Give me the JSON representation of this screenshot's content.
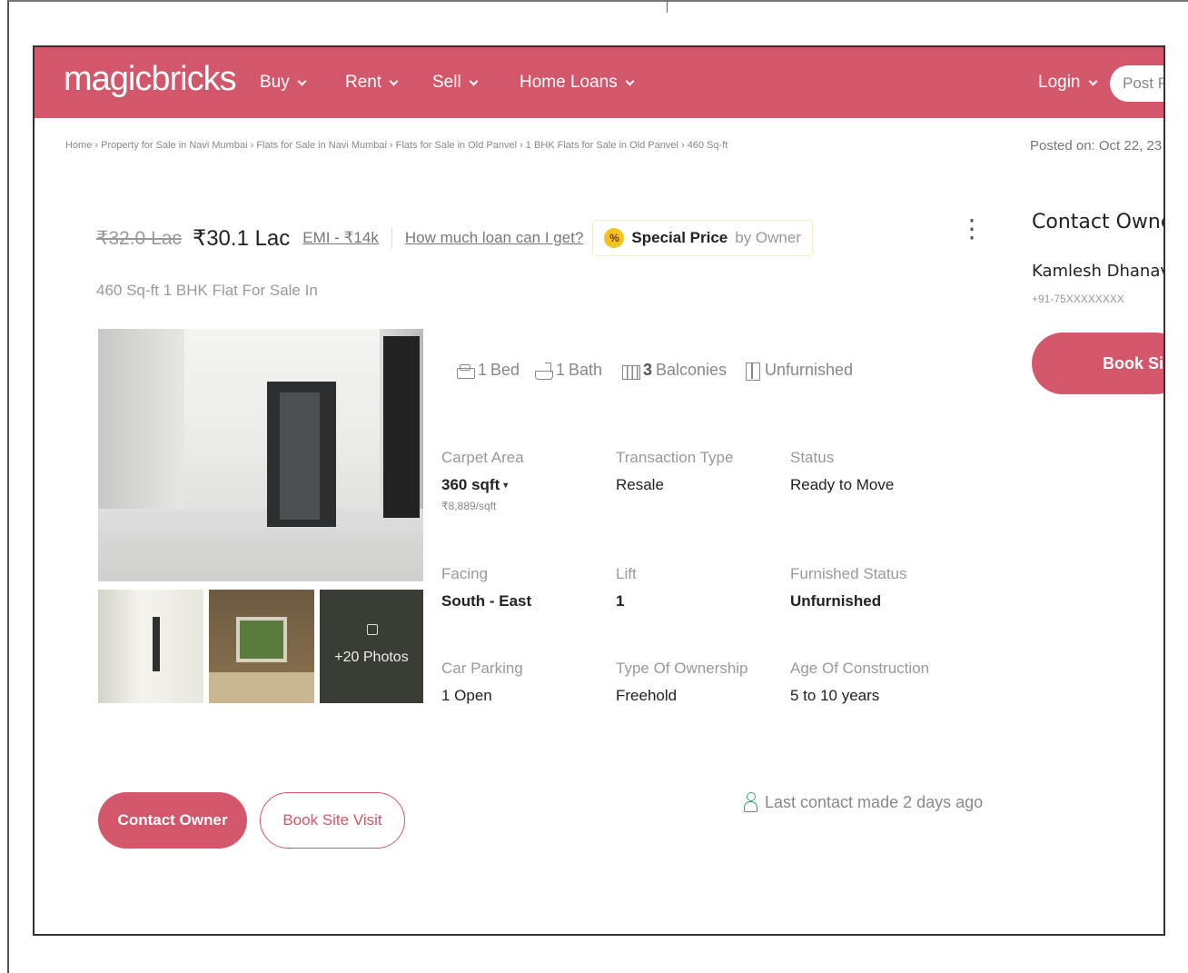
{
  "brand": {
    "logo": "magicbricks",
    "accent": "#d3576a"
  },
  "nav": {
    "items": [
      {
        "label": "Buy"
      },
      {
        "label": "Rent"
      },
      {
        "label": "Sell"
      },
      {
        "label": "Home Loans"
      }
    ],
    "login": "Login",
    "post_button": "Post P"
  },
  "breadcrumb": "Home › Property for Sale in Navi Mumbai › Flats for Sale in Navi Mumbai › Flats for Sale in Old Panvel › 1 BHK Flats for Sale in Old Panvel › 460 Sq-ft",
  "posted_on": "Posted on: Oct 22, 23",
  "price": {
    "old": "₹32.0 Lac",
    "new": "₹30.1 Lac",
    "emi": "EMI - ₹14k",
    "loan_link": "How much loan can I get?",
    "badge_strong": "Special Price",
    "badge_rest": "by Owner",
    "badge_icon": "%"
  },
  "subtitle": "460 Sq-ft 1 BHK Flat For Sale In",
  "photos": {
    "more_label": "+20 Photos"
  },
  "amenities": {
    "bed_count": "1",
    "bed_label": "Bed",
    "bath_count": "1",
    "bath_label": "Bath",
    "balcony_count": "3",
    "balcony_label": "Balconies",
    "furnish_label": "Unfurnished"
  },
  "specs": [
    {
      "label": "Carpet Area",
      "value": "360 sqft",
      "sub": "₹8,889/sqft"
    },
    {
      "label": "Transaction Type",
      "value": "Resale"
    },
    {
      "label": "Status",
      "value": "Ready to Move"
    },
    {
      "label": "Facing",
      "value": "South - East"
    },
    {
      "label": "Lift",
      "value": "1"
    },
    {
      "label": "Furnished Status",
      "value": "Unfurnished"
    },
    {
      "label": "Car Parking",
      "value": "1 Open"
    },
    {
      "label": "Type Of Ownership",
      "value": "Freehold"
    },
    {
      "label": "Age Of Construction",
      "value": "5 to 10 years"
    }
  ],
  "actions": {
    "contact_owner": "Contact Owner",
    "book_site_visit": "Book Site Visit",
    "last_contact": "Last contact made 2 days ago"
  },
  "sidebar": {
    "title": "Contact Owne",
    "owner_name": "Kamlesh Dhanav",
    "phone": "+91-75XXXXXXXX",
    "book_button": "Book Sit"
  }
}
